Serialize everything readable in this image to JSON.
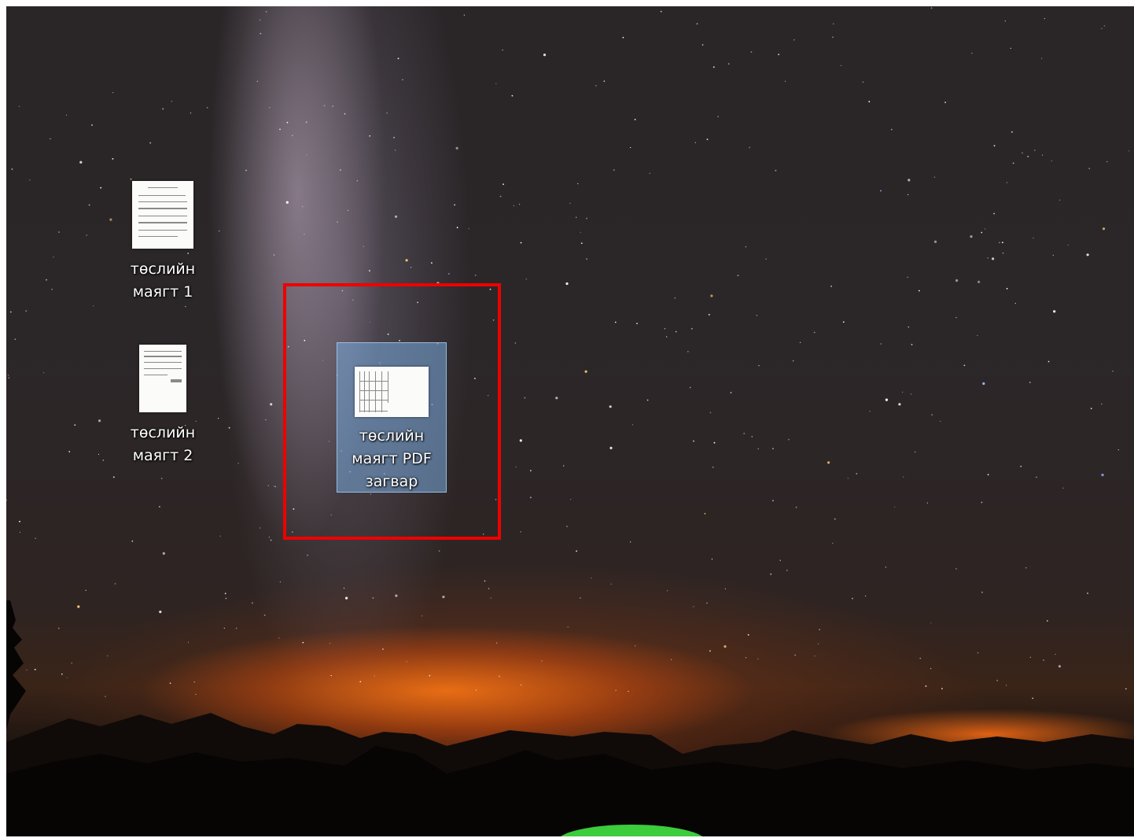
{
  "desktop": {
    "icons": [
      {
        "label": "төслийн\nмаягт 1",
        "type": "document-icon"
      },
      {
        "label": "төслийн\nмаягт 2",
        "type": "document-icon"
      },
      {
        "label": "төслийн\nмаягт PDF\nзагвар",
        "type": "pdf-document-icon",
        "selected": true
      }
    ],
    "annotation_color": "#ee0000",
    "selection_color": "#78aadc"
  }
}
